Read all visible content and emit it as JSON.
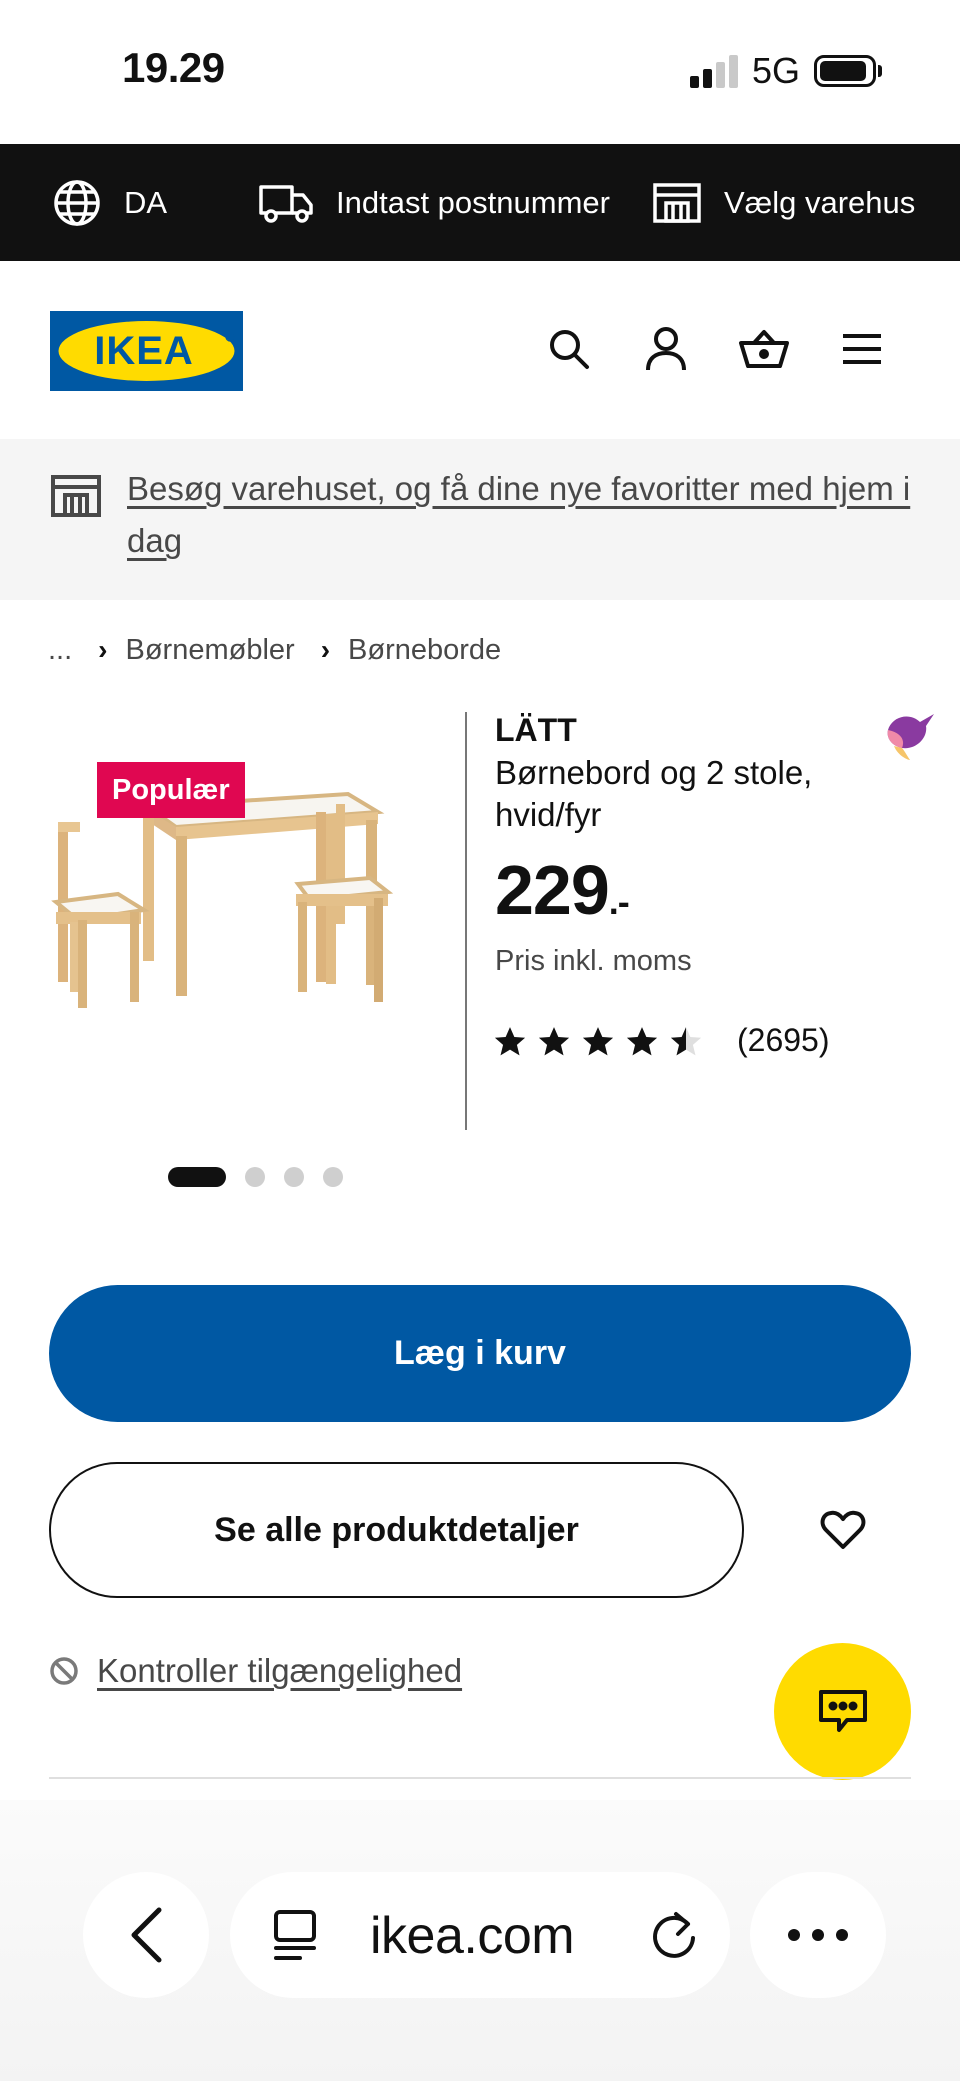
{
  "status_bar": {
    "time": "19.29",
    "network": "5G"
  },
  "topbar": {
    "language": "DA",
    "postcode": "Indtast postnummer",
    "store": "Vælg varehus"
  },
  "header": {
    "logo_text": "IKEA",
    "icons": [
      "search-icon",
      "account-icon",
      "basket-icon",
      "menu-icon"
    ]
  },
  "banner": {
    "text": "Besøg varehuset, og få dine nye favoritter med hjem i dag"
  },
  "breadcrumb": {
    "ellipsis": "...",
    "items": [
      "Børnemøbler",
      "Børneborde"
    ]
  },
  "product": {
    "badge": "Populær",
    "name": "LÄTT",
    "description": "Børnebord og 2 stole, hvid/fyr",
    "price": "229",
    "price_suffix": ".-",
    "vat_note": "Pris inkl. moms",
    "rating_value": 4.5,
    "rating_max": 5,
    "review_count": "(2695)",
    "image_count": 4,
    "active_image": 1
  },
  "actions": {
    "add_to_cart": "Læg i kurv",
    "see_details": "Se alle produktdetaljer",
    "check_availability": "Kontroller tilgængelighed"
  },
  "browser": {
    "url": "ikea.com"
  },
  "colors": {
    "primary_blue": "#0058a3",
    "badge_red": "#e00751",
    "chat_yellow": "#ffdb00",
    "topbar_black": "#111111",
    "logo_blue": "#0058a3",
    "logo_yellow": "#ffdb00"
  }
}
